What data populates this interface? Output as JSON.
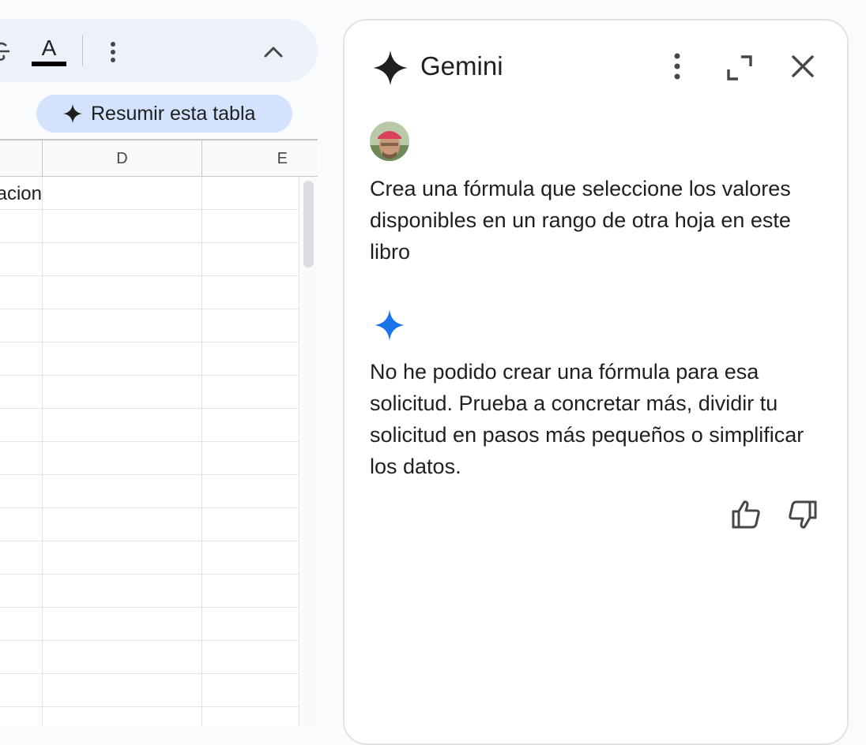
{
  "toolbar": {
    "text_color_letter": "A",
    "icons": [
      "strikethrough-icon",
      "text-color-icon",
      "more-vert-icon",
      "chevron-up-icon"
    ]
  },
  "summarize_button": {
    "label": "Resumir esta tabla"
  },
  "sheet": {
    "columns": [
      "D",
      "E"
    ],
    "rows": [
      [
        "rsacion",
        "",
        ""
      ],
      [
        "",
        "",
        ""
      ],
      [
        "",
        "",
        ""
      ],
      [
        "",
        "",
        ""
      ],
      [
        "",
        "",
        ""
      ],
      [
        "",
        "",
        ""
      ],
      [
        "",
        "",
        ""
      ],
      [
        "",
        "",
        ""
      ],
      [
        "",
        "",
        ""
      ],
      [
        "",
        "",
        ""
      ],
      [
        "",
        "",
        ""
      ],
      [
        "",
        "",
        ""
      ],
      [
        "",
        "",
        ""
      ],
      [
        "",
        "",
        ""
      ],
      [
        "",
        "",
        ""
      ],
      [
        "",
        "",
        ""
      ],
      [
        "",
        "",
        ""
      ]
    ]
  },
  "gemini_panel": {
    "title": "Gemini",
    "user_message": "Crea una fórmula que seleccione los valores disponibles en un rango de otra hoja en este libro",
    "ai_message": "No he podido crear una fórmula para esa solicitud. Prueba a concretar más, dividir tu solicitud en pasos más pequeños o simplificar los datos.",
    "colors": {
      "gemini_blue": "#1a73e8",
      "chip_bg": "#d3e3fd",
      "toolbar_bg": "#edf2fa"
    }
  }
}
